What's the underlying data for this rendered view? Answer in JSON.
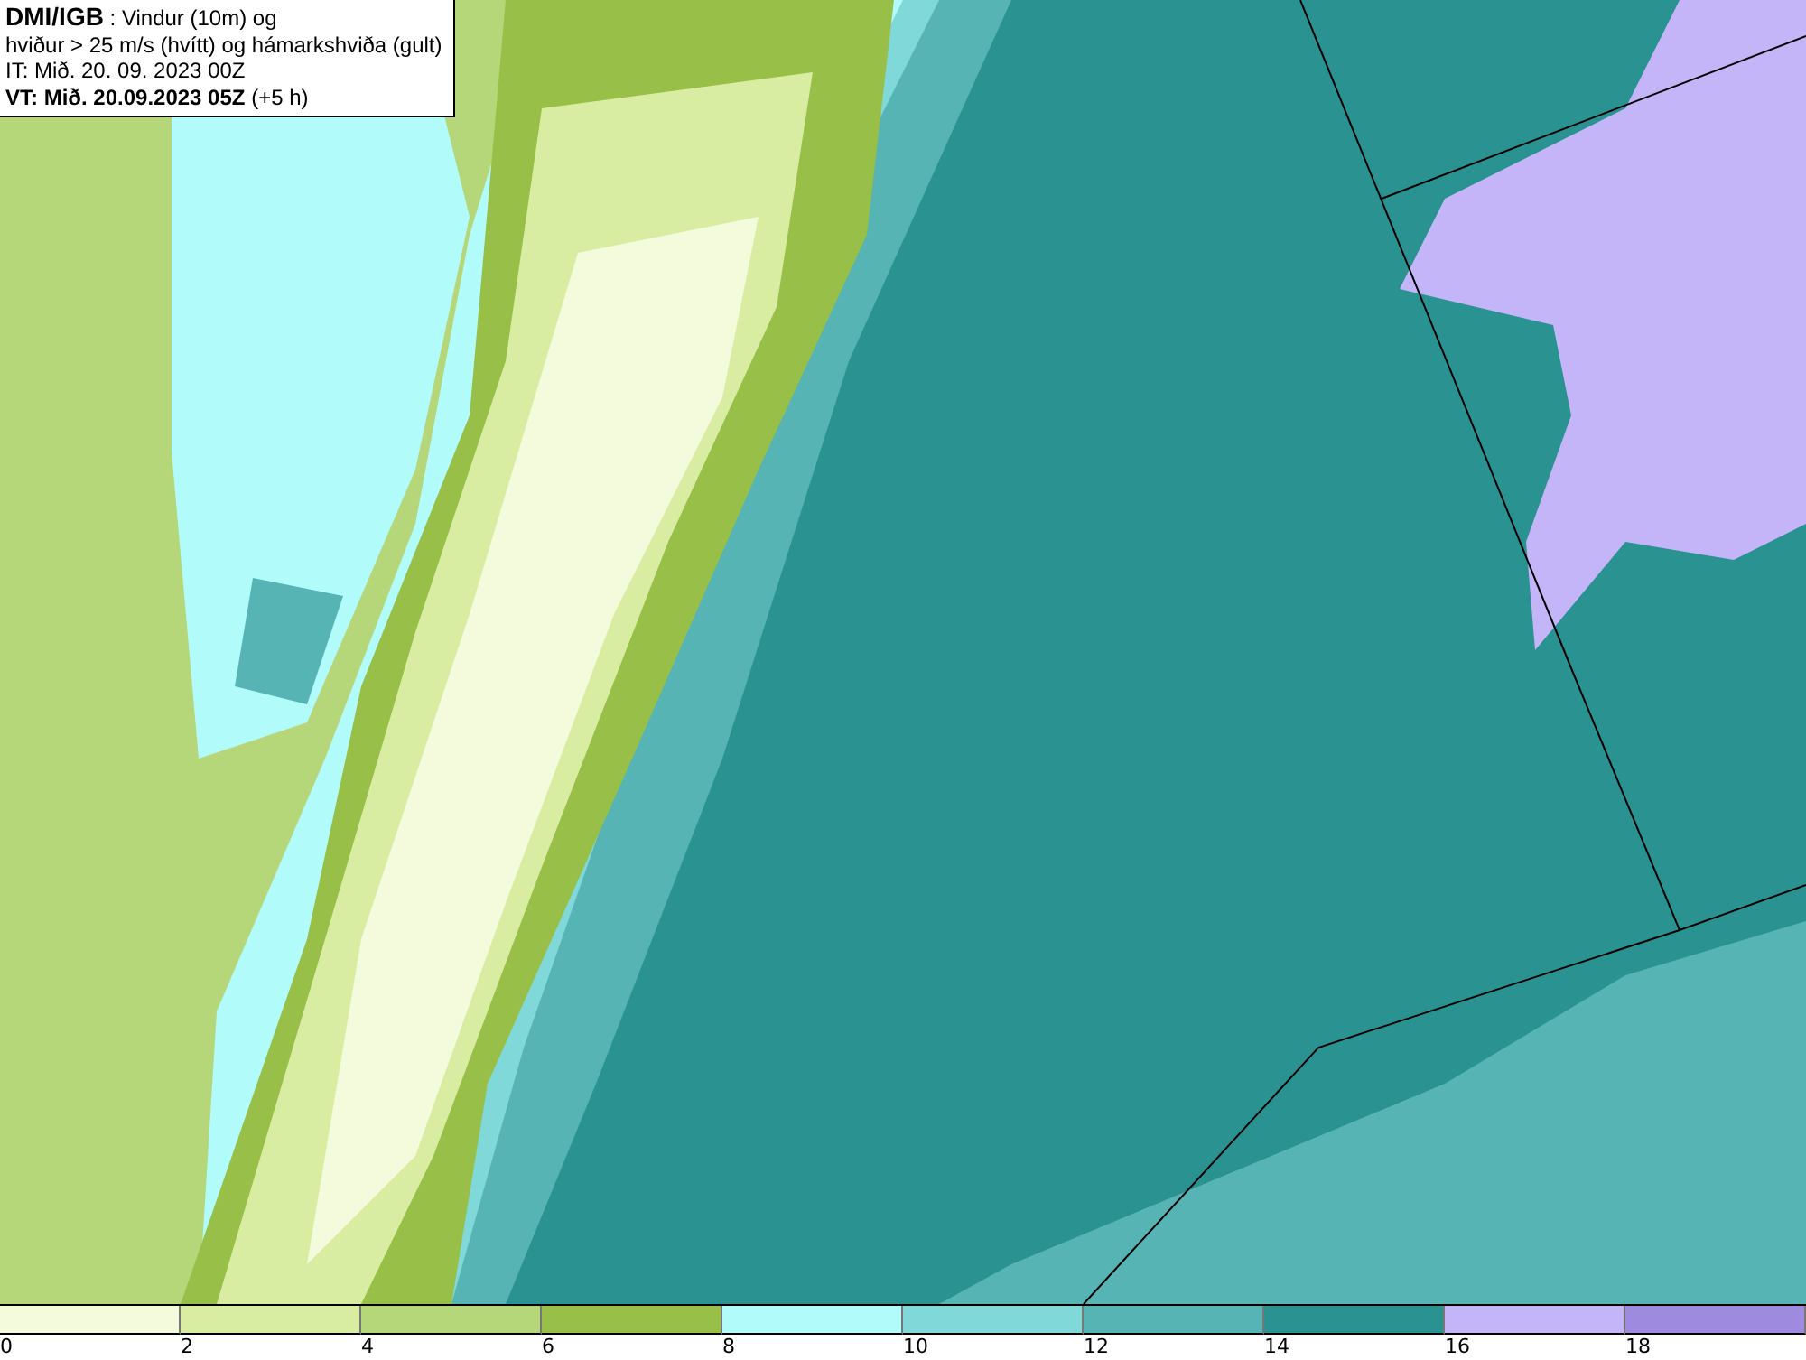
{
  "info_box": {
    "lines": [
      "**DMI/IGB** : Vindur (10m) og",
      "hviður > 25 m/s (hvítt) og hámarkshviða (gult)",
      "IT: Mið. 20. 09. 2023 00Z",
      "**VT: Mið. 20.09.2023 05Z** (+5 h)"
    ]
  },
  "legend": {
    "segments": [
      {
        "label": "0",
        "color": "#f4fadc"
      },
      {
        "label": "2",
        "color": "#d9eda2"
      },
      {
        "label": "4",
        "color": "#b6d779"
      },
      {
        "label": "6",
        "color": "#98bf48"
      },
      {
        "label": "8",
        "color": "#b2fbfb"
      },
      {
        "label": "10",
        "color": "#80d8d8"
      },
      {
        "label": "12",
        "color": "#56b4b4"
      },
      {
        "label": "14",
        "color": "#2b9292"
      },
      {
        "label": "16",
        "color": "#c3b5f7"
      },
      {
        "label": "18",
        "color": "#9e8be0"
      }
    ]
  }
}
